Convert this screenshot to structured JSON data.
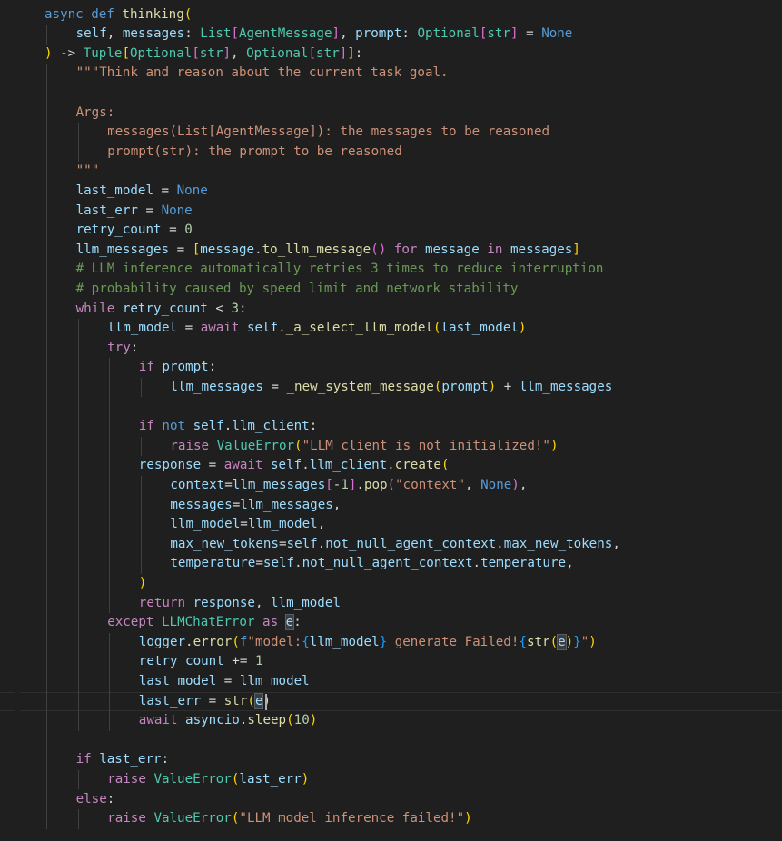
{
  "editor": {
    "language": "python",
    "lines": [
      {
        "indent": 0,
        "tokens": [
          [
            "kw",
            "async "
          ],
          [
            "kw",
            "def "
          ],
          [
            "fn",
            "thinking"
          ],
          [
            "b1",
            "("
          ]
        ]
      },
      {
        "indent": 1,
        "tokens": [
          [
            "var",
            "self"
          ],
          [
            "op",
            ", "
          ],
          [
            "var",
            "messages"
          ],
          [
            "op",
            ": "
          ],
          [
            "cls",
            "List"
          ],
          [
            "b2",
            "["
          ],
          [
            "cls",
            "AgentMessage"
          ],
          [
            "b2",
            "]"
          ],
          [
            "op",
            ", "
          ],
          [
            "var",
            "prompt"
          ],
          [
            "op",
            ": "
          ],
          [
            "cls",
            "Optional"
          ],
          [
            "b2",
            "["
          ],
          [
            "cls",
            "str"
          ],
          [
            "b2",
            "]"
          ],
          [
            "op",
            " = "
          ],
          [
            "kw",
            "None"
          ]
        ]
      },
      {
        "indent": 0,
        "tokens": [
          [
            "b1",
            ")"
          ],
          [
            "op",
            " -> "
          ],
          [
            "cls",
            "Tuple"
          ],
          [
            "b1",
            "["
          ],
          [
            "cls",
            "Optional"
          ],
          [
            "b2",
            "["
          ],
          [
            "cls",
            "str"
          ],
          [
            "b2",
            "]"
          ],
          [
            "op",
            ", "
          ],
          [
            "cls",
            "Optional"
          ],
          [
            "b2",
            "["
          ],
          [
            "cls",
            "str"
          ],
          [
            "b2",
            "]"
          ],
          [
            "b1",
            "]"
          ],
          [
            "op",
            ":"
          ]
        ]
      },
      {
        "indent": 1,
        "tokens": [
          [
            "str",
            "\"\"\"Think and reason about the current task goal."
          ]
        ]
      },
      {
        "indent": 0,
        "tokens": []
      },
      {
        "indent": 1,
        "tokens": [
          [
            "str",
            "Args:"
          ]
        ]
      },
      {
        "indent": 2,
        "tokens": [
          [
            "str",
            "messages(List[AgentMessage]): the messages to be reasoned"
          ]
        ]
      },
      {
        "indent": 2,
        "tokens": [
          [
            "str",
            "prompt(str): the prompt to be reasoned"
          ]
        ]
      },
      {
        "indent": 1,
        "tokens": [
          [
            "str",
            "\"\"\""
          ]
        ]
      },
      {
        "indent": 1,
        "tokens": [
          [
            "var",
            "last_model"
          ],
          [
            "op",
            " = "
          ],
          [
            "kw",
            "None"
          ]
        ]
      },
      {
        "indent": 1,
        "tokens": [
          [
            "var",
            "last_err"
          ],
          [
            "op",
            " = "
          ],
          [
            "kw",
            "None"
          ]
        ]
      },
      {
        "indent": 1,
        "tokens": [
          [
            "var",
            "retry_count"
          ],
          [
            "op",
            " = "
          ],
          [
            "num",
            "0"
          ]
        ]
      },
      {
        "indent": 1,
        "tokens": [
          [
            "var",
            "llm_messages"
          ],
          [
            "op",
            " = "
          ],
          [
            "b1",
            "["
          ],
          [
            "var",
            "message"
          ],
          [
            "op",
            "."
          ],
          [
            "fn",
            "to_llm_message"
          ],
          [
            "b2",
            "()"
          ],
          [
            "op",
            " "
          ],
          [
            "ctl",
            "for "
          ],
          [
            "var",
            "message"
          ],
          [
            "op",
            " "
          ],
          [
            "ctl",
            "in "
          ],
          [
            "var",
            "messages"
          ],
          [
            "b1",
            "]"
          ]
        ]
      },
      {
        "indent": 1,
        "tokens": [
          [
            "cmt",
            "# LLM inference automatically retries 3 times to reduce interruption"
          ]
        ]
      },
      {
        "indent": 1,
        "tokens": [
          [
            "cmt",
            "# probability caused by speed limit and network stability"
          ]
        ]
      },
      {
        "indent": 1,
        "tokens": [
          [
            "ctl",
            "while "
          ],
          [
            "var",
            "retry_count"
          ],
          [
            "op",
            " < "
          ],
          [
            "num",
            "3"
          ],
          [
            "op",
            ":"
          ]
        ]
      },
      {
        "indent": 2,
        "tokens": [
          [
            "var",
            "llm_model"
          ],
          [
            "op",
            " = "
          ],
          [
            "ctl",
            "await "
          ],
          [
            "var",
            "self"
          ],
          [
            "op",
            "."
          ],
          [
            "fn",
            "_a_select_llm_model"
          ],
          [
            "b1",
            "("
          ],
          [
            "var",
            "last_model"
          ],
          [
            "b1",
            ")"
          ]
        ]
      },
      {
        "indent": 2,
        "tokens": [
          [
            "ctl",
            "try"
          ],
          [
            "op",
            ":"
          ]
        ]
      },
      {
        "indent": 3,
        "tokens": [
          [
            "ctl",
            "if "
          ],
          [
            "var",
            "prompt"
          ],
          [
            "op",
            ":"
          ]
        ]
      },
      {
        "indent": 4,
        "tokens": [
          [
            "var",
            "llm_messages"
          ],
          [
            "op",
            " = "
          ],
          [
            "fn",
            "_new_system_message"
          ],
          [
            "b1",
            "("
          ],
          [
            "var",
            "prompt"
          ],
          [
            "b1",
            ")"
          ],
          [
            "op",
            " + "
          ],
          [
            "var",
            "llm_messages"
          ]
        ]
      },
      {
        "indent": 0,
        "tokens": []
      },
      {
        "indent": 3,
        "tokens": [
          [
            "ctl",
            "if "
          ],
          [
            "kw",
            "not "
          ],
          [
            "var",
            "self"
          ],
          [
            "op",
            "."
          ],
          [
            "var",
            "llm_client"
          ],
          [
            "op",
            ":"
          ]
        ]
      },
      {
        "indent": 4,
        "tokens": [
          [
            "ctl",
            "raise "
          ],
          [
            "cls",
            "ValueError"
          ],
          [
            "b1",
            "("
          ],
          [
            "str",
            "\"LLM client is not initialized!\""
          ],
          [
            "b1",
            ")"
          ]
        ]
      },
      {
        "indent": 3,
        "tokens": [
          [
            "var",
            "response"
          ],
          [
            "op",
            " = "
          ],
          [
            "ctl",
            "await "
          ],
          [
            "var",
            "self"
          ],
          [
            "op",
            "."
          ],
          [
            "var",
            "llm_client"
          ],
          [
            "op",
            "."
          ],
          [
            "fn",
            "create"
          ],
          [
            "b1",
            "("
          ]
        ]
      },
      {
        "indent": 4,
        "tokens": [
          [
            "var",
            "context"
          ],
          [
            "op",
            "="
          ],
          [
            "var",
            "llm_messages"
          ],
          [
            "b2",
            "["
          ],
          [
            "op",
            "-"
          ],
          [
            "num",
            "1"
          ],
          [
            "b2",
            "]"
          ],
          [
            "op",
            "."
          ],
          [
            "fn",
            "pop"
          ],
          [
            "b2",
            "("
          ],
          [
            "str",
            "\"context\""
          ],
          [
            "op",
            ", "
          ],
          [
            "kw",
            "None"
          ],
          [
            "b2",
            ")"
          ],
          [
            "op",
            ","
          ]
        ]
      },
      {
        "indent": 4,
        "tokens": [
          [
            "var",
            "messages"
          ],
          [
            "op",
            "="
          ],
          [
            "var",
            "llm_messages"
          ],
          [
            "op",
            ","
          ]
        ]
      },
      {
        "indent": 4,
        "tokens": [
          [
            "var",
            "llm_model"
          ],
          [
            "op",
            "="
          ],
          [
            "var",
            "llm_model"
          ],
          [
            "op",
            ","
          ]
        ]
      },
      {
        "indent": 4,
        "tokens": [
          [
            "var",
            "max_new_tokens"
          ],
          [
            "op",
            "="
          ],
          [
            "var",
            "self"
          ],
          [
            "op",
            "."
          ],
          [
            "var",
            "not_null_agent_context"
          ],
          [
            "op",
            "."
          ],
          [
            "var",
            "max_new_tokens"
          ],
          [
            "op",
            ","
          ]
        ]
      },
      {
        "indent": 4,
        "tokens": [
          [
            "var",
            "temperature"
          ],
          [
            "op",
            "="
          ],
          [
            "var",
            "self"
          ],
          [
            "op",
            "."
          ],
          [
            "var",
            "not_null_agent_context"
          ],
          [
            "op",
            "."
          ],
          [
            "var",
            "temperature"
          ],
          [
            "op",
            ","
          ]
        ]
      },
      {
        "indent": 3,
        "tokens": [
          [
            "b1",
            ")"
          ]
        ]
      },
      {
        "indent": 3,
        "tokens": [
          [
            "ctl",
            "return "
          ],
          [
            "var",
            "response"
          ],
          [
            "op",
            ", "
          ],
          [
            "var",
            "llm_model"
          ]
        ]
      },
      {
        "indent": 2,
        "tokens": [
          [
            "ctl",
            "except "
          ],
          [
            "cls",
            "LLMChatError"
          ],
          [
            "op",
            " "
          ],
          [
            "ctl",
            "as "
          ],
          [
            "hlvar",
            "e"
          ],
          [
            "op",
            ":"
          ]
        ]
      },
      {
        "indent": 3,
        "tokens": [
          [
            "var",
            "logger"
          ],
          [
            "op",
            "."
          ],
          [
            "fn",
            "error"
          ],
          [
            "b1",
            "("
          ],
          [
            "kw",
            "f"
          ],
          [
            "str",
            "\"model:"
          ],
          [
            "b3",
            "{"
          ],
          [
            "var",
            "llm_model"
          ],
          [
            "b3",
            "}"
          ],
          [
            "str",
            " generate Failed!"
          ],
          [
            "b3",
            "{"
          ],
          [
            "fn",
            "str"
          ],
          [
            "b1",
            "("
          ],
          [
            "hlvar",
            "e"
          ],
          [
            "b1",
            ")"
          ],
          [
            "b3",
            "}"
          ],
          [
            "str",
            "\""
          ],
          [
            "b1",
            ")"
          ]
        ]
      },
      {
        "indent": 3,
        "tokens": [
          [
            "var",
            "retry_count"
          ],
          [
            "op",
            " += "
          ],
          [
            "num",
            "1"
          ]
        ]
      },
      {
        "indent": 3,
        "tokens": [
          [
            "var",
            "last_model"
          ],
          [
            "op",
            " = "
          ],
          [
            "var",
            "llm_model"
          ]
        ]
      },
      {
        "indent": 3,
        "tokens": [
          [
            "var",
            "last_err"
          ],
          [
            "op",
            " = "
          ],
          [
            "fn",
            "str"
          ],
          [
            "b1",
            "("
          ],
          [
            "hlvar",
            "e"
          ],
          [
            "b1",
            ")"
          ]
        ],
        "current": true
      },
      {
        "indent": 3,
        "tokens": [
          [
            "ctl",
            "await "
          ],
          [
            "var",
            "asyncio"
          ],
          [
            "op",
            "."
          ],
          [
            "fn",
            "sleep"
          ],
          [
            "b1",
            "("
          ],
          [
            "num",
            "10"
          ],
          [
            "b1",
            ")"
          ]
        ]
      },
      {
        "indent": 0,
        "tokens": []
      },
      {
        "indent": 1,
        "tokens": [
          [
            "ctl",
            "if "
          ],
          [
            "var",
            "last_err"
          ],
          [
            "op",
            ":"
          ]
        ]
      },
      {
        "indent": 2,
        "tokens": [
          [
            "ctl",
            "raise "
          ],
          [
            "cls",
            "ValueError"
          ],
          [
            "b1",
            "("
          ],
          [
            "var",
            "last_err"
          ],
          [
            "b1",
            ")"
          ]
        ]
      },
      {
        "indent": 1,
        "tokens": [
          [
            "ctl",
            "else"
          ],
          [
            "op",
            ":"
          ]
        ]
      },
      {
        "indent": 2,
        "tokens": [
          [
            "ctl",
            "raise "
          ],
          [
            "cls",
            "ValueError"
          ],
          [
            "b1",
            "("
          ],
          [
            "str",
            "\"LLM model inference failed!\""
          ],
          [
            "b1",
            ")"
          ]
        ]
      }
    ]
  }
}
